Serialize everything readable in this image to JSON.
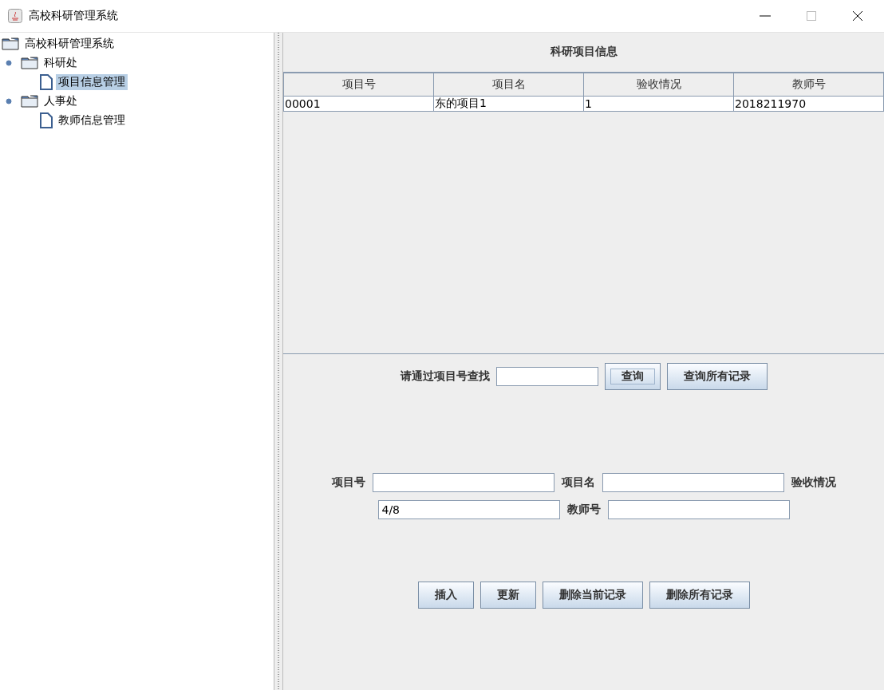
{
  "window": {
    "title": "高校科研管理系统"
  },
  "tree": {
    "label": "高校科研管理系统",
    "kind": "folder",
    "selected": false,
    "children": [
      {
        "label": "科研处",
        "kind": "folder",
        "expanded": true,
        "selected": false,
        "children": [
          {
            "label": "项目信息管理",
            "kind": "leaf",
            "selected": true
          }
        ]
      },
      {
        "label": "人事处",
        "kind": "folder",
        "expanded": true,
        "selected": false,
        "children": [
          {
            "label": "教师信息管理",
            "kind": "leaf",
            "selected": false
          }
        ]
      }
    ]
  },
  "panel_title": "科研项目信息",
  "table": {
    "columns": [
      "项目号",
      "项目名",
      "验收情况",
      "教师号"
    ],
    "rows": [
      [
        "00001",
        "东的项目1",
        "1",
        "2018211970"
      ]
    ]
  },
  "search": {
    "label": "请通过项目号查找",
    "buttons": [
      {
        "label": "查询",
        "focused": true
      },
      {
        "label": "查询所有记录",
        "focused": false
      }
    ]
  },
  "form": {
    "fields": [
      {
        "label": "项目号"
      },
      {
        "label": "项目名"
      },
      {
        "label": "验收情况",
        "value": "4/8"
      },
      {
        "label": "教师号"
      }
    ]
  },
  "actions": [
    "插入",
    "更新",
    "删除当前记录",
    "删除所有记录"
  ]
}
